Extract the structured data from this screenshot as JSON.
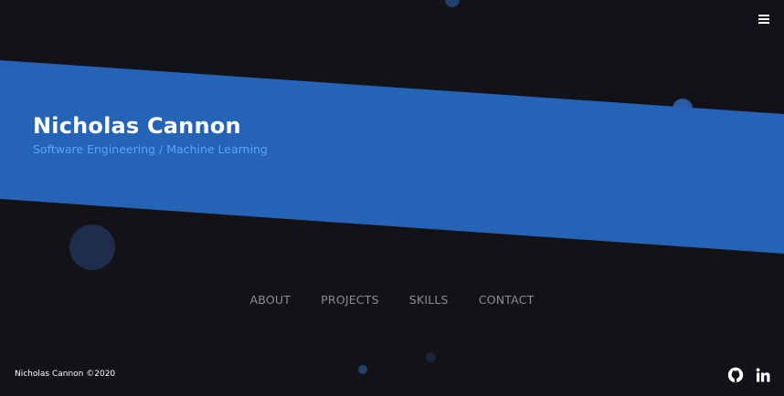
{
  "header": {
    "menu_icon": "hamburger-menu-icon"
  },
  "hero": {
    "name": "Nicholas Cannon",
    "subtitle": "Software Engineering / Machine Learning"
  },
  "nav": {
    "items": [
      {
        "label": "ABOUT"
      },
      {
        "label": "PROJECTS"
      },
      {
        "label": "SKILLS"
      },
      {
        "label": "CONTACT"
      }
    ]
  },
  "footer": {
    "copyright": "Nicholas Cannon ©2020",
    "social": [
      {
        "icon": "github-icon"
      },
      {
        "icon": "linkedin-icon"
      }
    ]
  },
  "colors": {
    "background": "#121217",
    "band": "#2563b7",
    "subtitle": "#59a3ff",
    "nav_text": "#8a8d94"
  }
}
